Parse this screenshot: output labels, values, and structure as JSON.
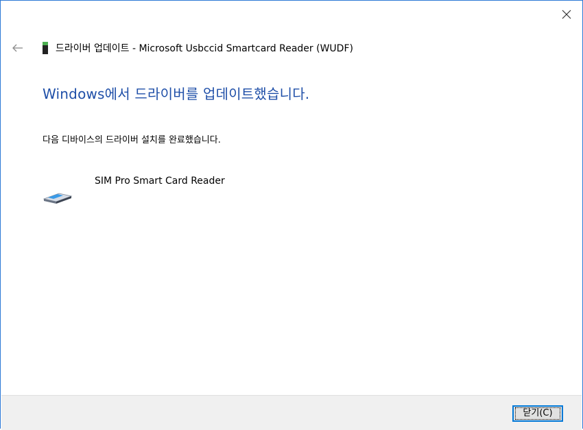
{
  "window": {
    "breadcrumb_title": "드라이버 업데이트 - Microsoft Usbccid Smartcard Reader (WUDF)"
  },
  "icons": {
    "close": "close-icon",
    "back": "back-arrow-icon",
    "usb": "usb-device-icon",
    "smartcard": "smartcard-reader-icon"
  },
  "main": {
    "heading": "Windows에서 드라이버를 업데이트했습니다.",
    "description": "다음 디바이스의 드라이버 설치를 완료했습니다.",
    "device_name": "SIM Pro Smart Card Reader"
  },
  "footer": {
    "close_button_label": "닫기(C)"
  },
  "colors": {
    "accent": "#1f4fa8",
    "border": "#2b78d6",
    "footer_bg": "#f0f0f0"
  }
}
